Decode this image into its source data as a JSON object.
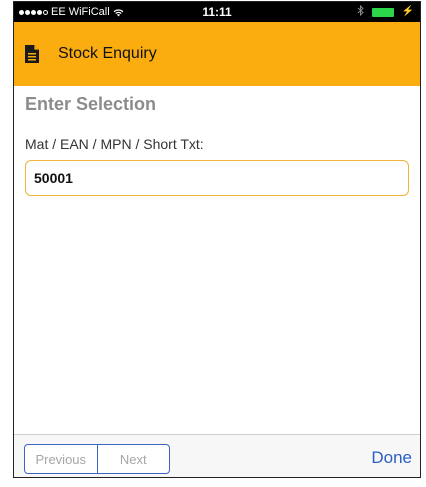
{
  "status_bar": {
    "carrier": "EE WiFiCall",
    "time": "11:11",
    "bluetooth_icon": "bluetooth-icon",
    "wifi_icon": "wifi-icon",
    "battery_icon": "battery-icon"
  },
  "header": {
    "title": "Stock Enquiry",
    "icon": "document-icon",
    "background": "#fbad0f"
  },
  "form": {
    "section_title": "Enter Selection",
    "field_label": "Mat / EAN / MPN / Short Txt:",
    "field_value": "50001",
    "field_border_color": "#f0b43c"
  },
  "bottom_bar": {
    "previous_label": "Previous",
    "next_label": "Next",
    "done_label": "Done",
    "accent": "#2a5fc4"
  }
}
